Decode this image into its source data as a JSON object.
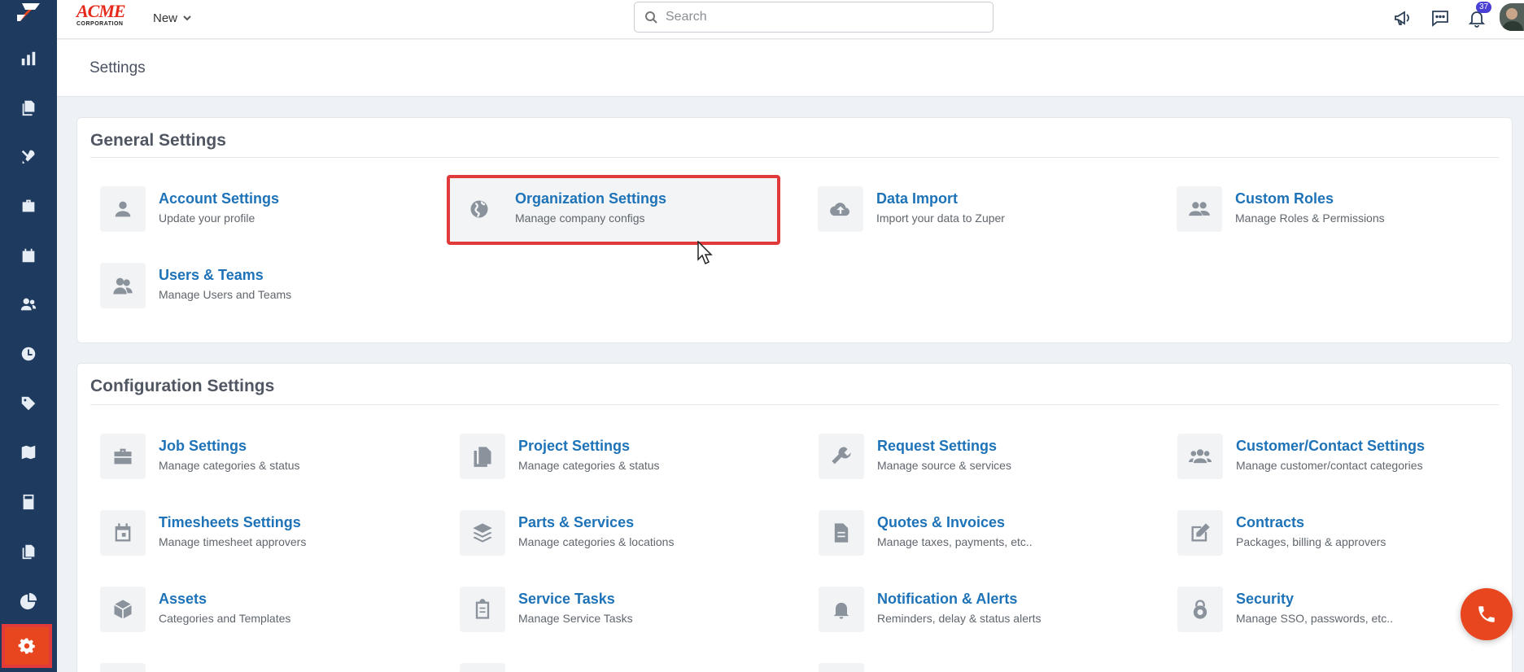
{
  "topbar": {
    "brand_name": "ACME",
    "brand_sub": "CORPORATION",
    "new_label": "New",
    "search_placeholder": "Search",
    "notification_count": "37"
  },
  "page": {
    "title": "Settings"
  },
  "sections": {
    "general": {
      "title": "General Settings",
      "items": [
        {
          "title": "Account Settings",
          "subtitle": "Update your profile",
          "icon": "person-icon"
        },
        {
          "title": "Organization Settings",
          "subtitle": "Manage company configs",
          "icon": "globe-icon",
          "highlighted": true
        },
        {
          "title": "Data Import",
          "subtitle": "Import your data to Zuper",
          "icon": "cloud-upload-icon"
        },
        {
          "title": "Custom Roles",
          "subtitle": "Manage Roles & Permissions",
          "icon": "people-icon"
        },
        {
          "title": "Users & Teams",
          "subtitle": "Manage Users and Teams",
          "icon": "users-icon"
        }
      ]
    },
    "configuration": {
      "title": "Configuration Settings",
      "items": [
        {
          "title": "Job Settings",
          "subtitle": "Manage categories & status",
          "icon": "briefcase-icon"
        },
        {
          "title": "Project Settings",
          "subtitle": "Manage categories & status",
          "icon": "documents-icon"
        },
        {
          "title": "Request Settings",
          "subtitle": "Manage source & services",
          "icon": "wrench-icon"
        },
        {
          "title": "Customer/Contact Settings",
          "subtitle": "Manage customer/contact categories",
          "icon": "group-icon"
        },
        {
          "title": "Timesheets Settings",
          "subtitle": "Manage timesheet approvers",
          "icon": "calendar-icon"
        },
        {
          "title": "Parts & Services",
          "subtitle": "Manage categories & locations",
          "icon": "layers-icon"
        },
        {
          "title": "Quotes & Invoices",
          "subtitle": "Manage taxes, payments, etc..",
          "icon": "invoice-icon"
        },
        {
          "title": "Contracts",
          "subtitle": "Packages, billing & approvers",
          "icon": "edit-icon"
        },
        {
          "title": "Assets",
          "subtitle": "Categories and Templates",
          "icon": "cube-icon"
        },
        {
          "title": "Service Tasks",
          "subtitle": "Manage Service Tasks",
          "icon": "clipboard-icon"
        },
        {
          "title": "Notification & Alerts",
          "subtitle": "Reminders, delay & status alerts",
          "icon": "bell-icon"
        },
        {
          "title": "Security",
          "subtitle": "Manage SSO, passwords, etc..",
          "icon": "lock-icon"
        }
      ]
    }
  },
  "sidebar": {
    "items": [
      "dashboard-icon",
      "jobs-icon",
      "tools-icon",
      "briefcase-icon",
      "calendar-icon",
      "customers-icon",
      "timesheet-icon",
      "tag-icon",
      "map-icon",
      "calculator-icon",
      "documents-icon",
      "reports-icon",
      "settings-icon"
    ],
    "active": "settings-icon"
  },
  "colors": {
    "sidebar": "#1f3a5f",
    "accent": "#e8461f",
    "link": "#1e73b8",
    "highlight_border": "#e03a3a"
  }
}
